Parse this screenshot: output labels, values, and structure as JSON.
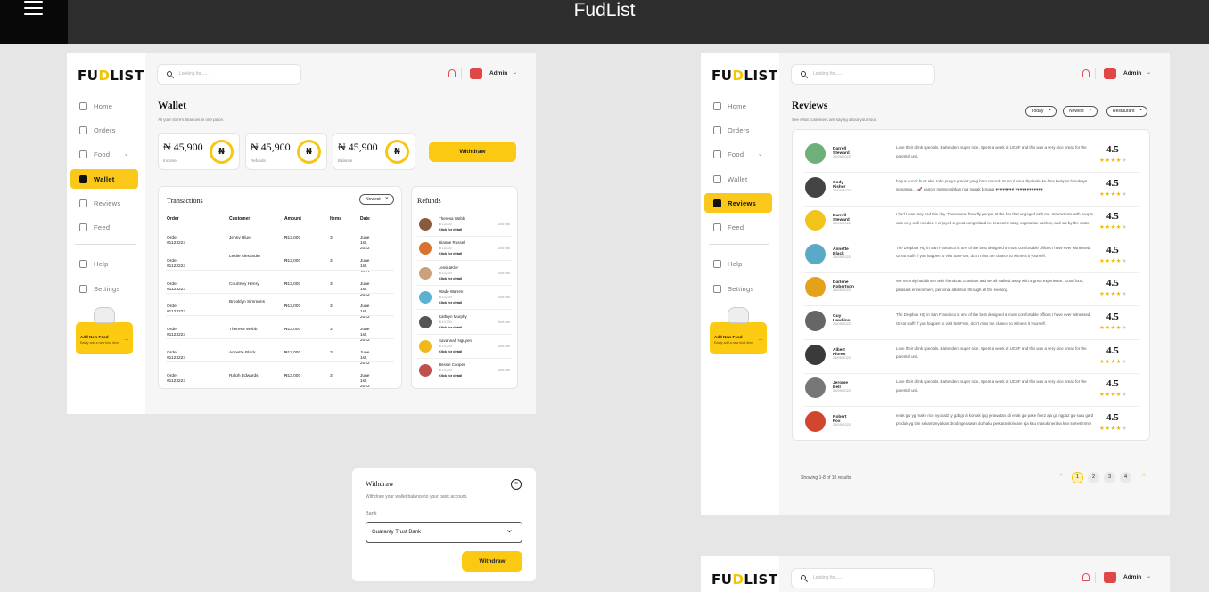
{
  "app": {
    "title": "FudList"
  },
  "brand": {
    "logo_text": "FUDLIST",
    "accent": "#F9C81B"
  },
  "search": {
    "placeholder": "Looking for......"
  },
  "header": {
    "admin": "Admin"
  },
  "nav": {
    "home": "Home",
    "orders": "Orders",
    "food": "Food",
    "wallet": "Wallet",
    "reviews": "Reviews",
    "feed": "Feed",
    "help": "Help",
    "settings": "Settings"
  },
  "promo": {
    "title": "Add New Food",
    "sub": "Easily add a new food item"
  },
  "wallet": {
    "title": "Wallet",
    "subtitle": "All your store's finances in one place.",
    "stats": [
      {
        "value": "₦ 45,900",
        "label": "Income",
        "icon": "₦"
      },
      {
        "value": "₦ 45,900",
        "label": "Refunds",
        "icon": "₦"
      },
      {
        "value": "₦ 45,900",
        "label": "Balance",
        "icon": "₦"
      }
    ],
    "withdraw_label": "Withdraw",
    "transactions": {
      "title": "Transactions",
      "filter": "Newest",
      "columns": [
        "Order",
        "Customer",
        "Amount",
        "Items",
        "Date"
      ],
      "rows": [
        [
          "Order #1123223",
          "Jenny Blue",
          "₦13,000",
          "3",
          "June 1st, 2022"
        ],
        [
          "Order #1123223",
          "Leslie Alexander",
          "₦13,000",
          "3",
          "June 1st, 2022"
        ],
        [
          "Order #1123223",
          "Courtney Henry",
          "₦13,000",
          "3",
          "June 1st, 2022"
        ],
        [
          "Order #1123223",
          "Brooklyn Simmons",
          "₦13,000",
          "3",
          "June 1st, 2022"
        ],
        [
          "Order #1123223",
          "Theresa Webb",
          "₦13,000",
          "3",
          "June 1st, 2022"
        ],
        [
          "Order #1123223",
          "Annette Black",
          "₦13,000",
          "3",
          "June 1st, 2022"
        ],
        [
          "Order #1123223",
          "Ralph Edwards",
          "₦13,000",
          "3",
          "June 1st, 2022"
        ]
      ]
    },
    "refunds": {
      "title": "Refunds",
      "click_label": "Click for detail",
      "time_label": "Just now",
      "items": [
        {
          "name": "Theresa Webb",
          "amount": "₦ 13,000",
          "color": "#8a5a3c"
        },
        {
          "name": "Dianne Russell",
          "amount": "₦ 13,000",
          "color": "#d9722e"
        },
        {
          "name": "Jessi aKlor",
          "amount": "₦ 13,000",
          "color": "#c9a27a"
        },
        {
          "name": "Wade Warren",
          "amount": "₦ 13,000",
          "color": "#5ab2d0"
        },
        {
          "name": "Kathryn Murphy",
          "amount": "₦ 13,000",
          "color": "#555555"
        },
        {
          "name": "Savannah Nguyen",
          "amount": "₦ 13,000",
          "color": "#f2b81a"
        },
        {
          "name": "Bessie Cooper",
          "amount": "₦ 13,000",
          "color": "#c0504d"
        }
      ]
    }
  },
  "modal": {
    "title": "Withdraw",
    "subtitle": "Withdraw your wallet balance to your bank account.",
    "bank_label": "Bank",
    "bank_value": "Guaranty Trust Bank",
    "button": "Withdraw"
  },
  "reviews": {
    "title": "Reviews",
    "subtitle": "See what customers are saying about your food",
    "filters": [
      "Today",
      "Newest",
      "Restaurant"
    ],
    "items": [
      {
        "name": "Darrell Steward",
        "date": "26/05/2022",
        "text": "Love their drink specials. Bartenders super nice. Spent a week at UCSF and this was a very nice break for the parental unit.",
        "score": "4.5",
        "color": "#6fb07a"
      },
      {
        "name": "Cody Fisher",
        "date": "26/05/2022",
        "text": "bagus cocok buat aku. toko punya praniat yang baru muncul muncul terus dipaketin ke bisa kempes bosoknya. semangg.... 🚀 dancer mensenahkan nya nggak bosong ♥♥♥♥♥♥♥♥ ♥♥♥♥♥♥♥♥♥♥♥♥",
        "score": "4.5",
        "color": "#444444"
      },
      {
        "name": "Darrell Steward",
        "date": "26/05/2022",
        "text": "I had I was very sad this day. There were friendly people at the bar that engaged with me. Interactions with people was very well needed. I enjoyed a great Long Island ice tea some tasty vegetarian nachos, and sat by the water",
        "score": "4.5",
        "color": "#f2c31a"
      },
      {
        "name": "Annette Black",
        "date": "26/05/2022",
        "text": "The Dropbox HQ in San Francisco is one of the best designed & most comfortable offices I have ever witnessed. Great stuff! If you happen to visit SanFran, don't miss the chance to witness it yourself.",
        "score": "4.5",
        "color": "#5aa9c9"
      },
      {
        "name": "Darlene Robertson",
        "date": "26/05/2022",
        "text": "We recently had dinner with friends at Gravitate and we all walked away with a great experience. Good food, pleasant environment, personal attention through all the evening.",
        "score": "4.5",
        "color": "#e3a21a"
      },
      {
        "name": "Guy Hawkins",
        "date": "26/05/2022",
        "text": "The Dropbox HQ in San Francisco is one of the best designed & most comfortable offices I have ever witnessed. Great stuff! If you happen to visit SanFran, don't miss the chance to witness it yourself.",
        "score": "4.5",
        "color": "#666666"
      },
      {
        "name": "Albert Flores",
        "date": "26/05/2022",
        "text": "Love their drink specials. Bartenders super nice. Spent a week at UCSF and this was a very nice break for the parental unit.",
        "score": "4.5",
        "color": "#3a3a3a"
      },
      {
        "name": "Jerome Bell",
        "date": "26/05/2022",
        "text": "Love their drink specials. Bartenders super nice. Spent a week at UCSF and this was a very nice break for the parental unit.",
        "score": "4.5",
        "color": "#777777"
      },
      {
        "name": "Robert Fox",
        "date": "26/05/2022",
        "text": "enak gw yg make rice nyobal2 ty gabgt di komak ijpg jerawatan. di enak gw pake fine2 aja ga ngpa2 gw suru gard produk yg lain sekampnya kan drod ngebawan durhaka perkara skincare aja kau masuk neraka kan sometimmm",
        "score": "4.5",
        "color": "#d0462f"
      }
    ],
    "stars": "★★★★",
    "empty_star": "★",
    "showing": "Showing 1-8 of 10 results",
    "pages": [
      "1",
      "2",
      "3",
      "4"
    ],
    "prev": "«",
    "next": "»"
  }
}
